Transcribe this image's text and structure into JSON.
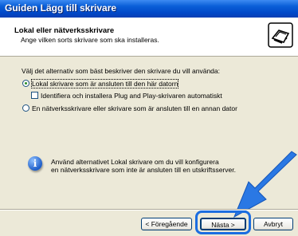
{
  "window": {
    "title": "Guiden Lägg till skrivare"
  },
  "header": {
    "title": "Lokal eller nätverksskrivare",
    "subtitle": "Ange vilken sorts skrivare som ska installeras.",
    "icon": "printer-wizard-icon"
  },
  "main": {
    "instruction": "Välj det alternativ som bäst beskriver den skrivare du vill använda:",
    "option_local": {
      "label": "Lokal skrivare som är ansluten till den här datorn",
      "selected": true
    },
    "plug_and_play": {
      "label": "Identifiera och installera Plug and Play-skrivaren automatiskt",
      "checked": false
    },
    "option_network": {
      "label": "En nätverksskrivare eller skrivare som är ansluten till en annan dator",
      "selected": false
    },
    "info_line1": "Använd alternativet Lokal skrivare om du vill konfigurera",
    "info_line2": "en nätverksskrivare som inte är ansluten till en utskriftsserver."
  },
  "buttons": {
    "back": "< Föregående",
    "next": "Nästa >",
    "cancel": "Avbryt"
  },
  "colors": {
    "titlebar": "#0a5fd8",
    "dialog_bg": "#ece9d8",
    "highlight": "#1b6de0"
  }
}
